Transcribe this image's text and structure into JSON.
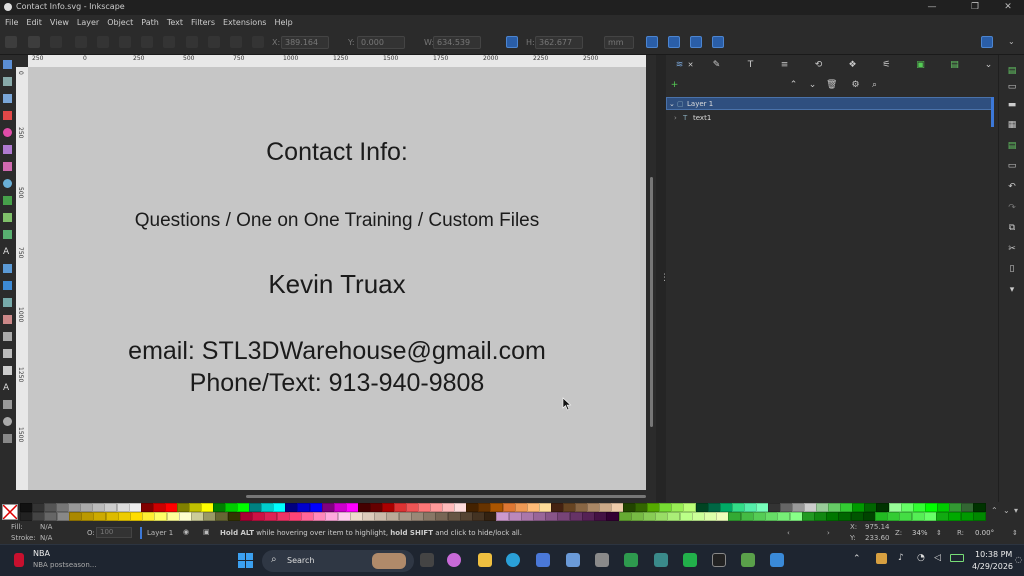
{
  "window": {
    "title": "Contact Info.svg - Inkscape",
    "minimize": "—",
    "maximize": "❐",
    "close": "✕"
  },
  "menu": [
    "File",
    "Edit",
    "View",
    "Layer",
    "Object",
    "Path",
    "Text",
    "Filters",
    "Extensions",
    "Help"
  ],
  "toolbar": {
    "x_label": "X:",
    "x_value": "389.164",
    "y_label": "Y:",
    "y_value": "0.000",
    "w_label": "W:",
    "w_value": "634.539",
    "h_label": "H:",
    "h_value": "362.677",
    "unit": "mm"
  },
  "ruler": {
    "h_ticks": [
      "250",
      "0",
      "250",
      "500",
      "750",
      "1000",
      "1250",
      "1500",
      "1750",
      "2000",
      "2250",
      "2500"
    ],
    "v_ticks": [
      "0",
      "250",
      "500",
      "750",
      "1000",
      "1250",
      "1500"
    ]
  },
  "document": {
    "heading": "Contact Info:",
    "services": "Questions / One on One Training / Custom Files",
    "name": "Kevin Truax",
    "email": "email: STL3DWarehouse@gmail.com",
    "phone": "Phone/Text: 913-940-9808"
  },
  "layers_panel": {
    "layer": "Layer 1",
    "child": "text1"
  },
  "status": {
    "fill_label": "Fill:",
    "fill_value": "N/A",
    "stroke_label": "Stroke:",
    "stroke_value": "N/A",
    "opacity_label": "O:",
    "opacity_value": "100",
    "layer": "Layer 1",
    "message_b1": "Hold ALT",
    "message_1": " while hovering over item to highlight, ",
    "message_b2": "hold SHIFT",
    "message_2": " and click to hide/lock all.",
    "x_label": "X:",
    "x_value": "975.14",
    "y_label": "Y:",
    "y_value": "233.60",
    "zoom_label": "Z:",
    "zoom_value": "34%",
    "rotation_label": "R:",
    "rotation_value": "0.00°"
  },
  "taskbar": {
    "news_title": "NBA",
    "news_sub": "NBA postseason...",
    "search": "Search",
    "time": "10:38 PM",
    "date": "4/29/2026"
  }
}
